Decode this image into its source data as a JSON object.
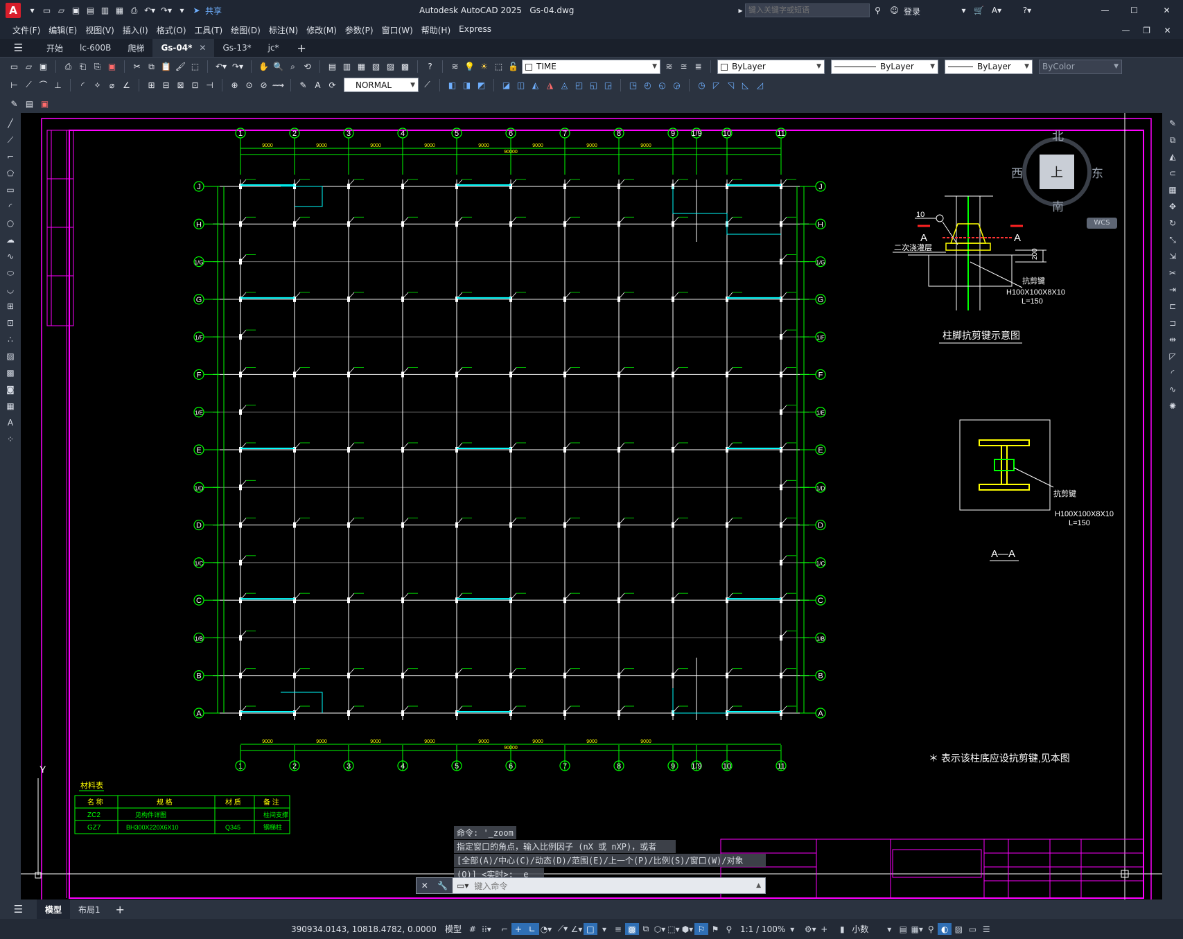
{
  "app": {
    "title": "Autodesk AutoCAD 2025",
    "filename": "Gs-04.dwg",
    "share": "共享",
    "search_placeholder": "键入关键字或短语",
    "login": "登录"
  },
  "menu": [
    "文件(F)",
    "编辑(E)",
    "视图(V)",
    "插入(I)",
    "格式(O)",
    "工具(T)",
    "绘图(D)",
    "标注(N)",
    "修改(M)",
    "参数(P)",
    "窗口(W)",
    "帮助(H)",
    "Express"
  ],
  "tabs": [
    {
      "label": "开始",
      "active": false
    },
    {
      "label": "lc-600B",
      "active": false
    },
    {
      "label": "爬梯",
      "active": false
    },
    {
      "label": "Gs-04*",
      "active": true
    },
    {
      "label": "Gs-13*",
      "active": false
    },
    {
      "label": "jc*",
      "active": false
    }
  ],
  "toolbar": {
    "layer_combo": "TIME",
    "color_combo": "ByLayer",
    "linetype_combo": "ByLayer",
    "lineweight_combo": "ByLayer",
    "plotstyle_combo": "ByColor",
    "textstyle_combo": "NORMAL"
  },
  "viewcube": {
    "north": "北",
    "south": "南",
    "east": "东",
    "west": "西",
    "face": "上",
    "wcs": "WCS"
  },
  "drawing": {
    "col_labels": [
      "1",
      "2",
      "3",
      "4",
      "5",
      "6",
      "7",
      "8",
      "9",
      "1/9",
      "10",
      "11"
    ],
    "row_labels": [
      "J",
      "H",
      "1/G",
      "G",
      "1/F",
      "F",
      "1/E",
      "E",
      "1/D",
      "D",
      "1/C",
      "C",
      "1/B",
      "B",
      "A"
    ],
    "bay_dim": "9000",
    "total_dim": "90000",
    "detail1_title": "柱脚抗剪键示意图",
    "detail1_note1": "二次浇灌层",
    "detail1_note2": "抗剪键",
    "detail1_spec": "H100X100X8X10",
    "detail1_len": "L=150",
    "detail1_dim": "200",
    "detail1_num": "10",
    "section_mark": "A",
    "detail2_title": "A—A",
    "detail2_note": "抗剪键",
    "detail2_spec": "H100X100X8X10",
    "detail2_len": "L=150",
    "legend_note": "＊ 表示该柱底应设抗剪键,见本图",
    "material_table": {
      "title": "材料表",
      "headers": [
        "名 称",
        "规 格",
        "材 质",
        "备 注"
      ],
      "rows": [
        [
          "ZC2",
          "见构件详图",
          "",
          "柱间支撑"
        ],
        [
          "GZ7",
          "BH300X220X6X10",
          "Q345",
          "钢梯柱"
        ]
      ]
    },
    "ucs_y": "Y"
  },
  "command": {
    "history": [
      "命令: '_zoom",
      "指定窗口的角点，输入比例因子 (nX 或 nXP)，或者",
      "[全部(A)/中心(C)/动态(D)/范围(E)/上一个(P)/比例(S)/窗口(W)/对象",
      "(O)] <实时>: _e"
    ],
    "placeholder": "键入命令"
  },
  "layouts": [
    {
      "label": "模型",
      "active": true
    },
    {
      "label": "布局1",
      "active": false
    }
  ],
  "status": {
    "coords": "390934.0143, 10818.4782, 0.0000",
    "model": "模型",
    "scale": "1:1 / 100%",
    "units": "小数"
  },
  "colors": {
    "canvas": "#000000",
    "magenta": "#ff00ff",
    "green": "#00ff00",
    "cyan": "#00ffff",
    "yellow": "#ffff00",
    "accent": "#2f6fb5"
  }
}
